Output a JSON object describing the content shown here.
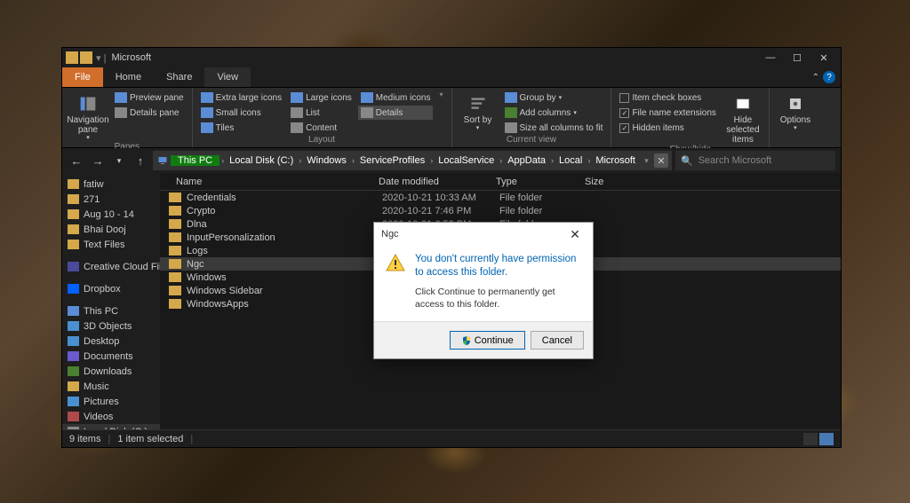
{
  "window": {
    "title": "Microsoft",
    "tabs": {
      "file": "File",
      "home": "Home",
      "share": "Share",
      "view": "View"
    },
    "ribbon": {
      "panes": {
        "label": "Panes",
        "nav_pane": "Navigation pane",
        "preview": "Preview pane",
        "details": "Details pane"
      },
      "layout": {
        "label": "Layout",
        "xl_icons": "Extra large icons",
        "l_icons": "Large icons",
        "m_icons": "Medium icons",
        "s_icons": "Small icons",
        "list": "List",
        "details": "Details",
        "tiles": "Tiles",
        "content": "Content"
      },
      "current": {
        "label": "Current view",
        "sort": "Sort by",
        "group": "Group by",
        "add_cols": "Add columns",
        "size_cols": "Size all columns to fit"
      },
      "show": {
        "label": "Show/hide",
        "item_chk": "Item check boxes",
        "ext": "File name extensions",
        "hidden": "Hidden items",
        "hide_sel": "Hide selected items"
      },
      "options": "Options"
    },
    "breadcrumb": [
      "This PC",
      "Local Disk (C:)",
      "Windows",
      "ServiceProfiles",
      "LocalService",
      "AppData",
      "Local",
      "Microsoft"
    ],
    "search_placeholder": "Search Microsoft",
    "sidebar": {
      "quick": [
        "fatiw",
        "271",
        "Aug 10 - 14",
        "Bhai Dooj",
        "Text Files"
      ],
      "cloud": [
        "Creative Cloud Fil"
      ],
      "dropbox": "Dropbox",
      "pc": "This PC",
      "pc_items": [
        "3D Objects",
        "Desktop",
        "Documents",
        "Downloads",
        "Music",
        "Pictures",
        "Videos",
        "Local Disk (C:)"
      ]
    },
    "columns": {
      "name": "Name",
      "date": "Date modified",
      "type": "Type",
      "size": "Size"
    },
    "rows": [
      {
        "name": "Credentials",
        "date": "2020-10-21 10:33 AM",
        "type": "File folder",
        "size": ""
      },
      {
        "name": "Crypto",
        "date": "2020-10-21 7:46 PM",
        "type": "File folder",
        "size": ""
      },
      {
        "name": "Dlna",
        "date": "2020-10-21 6:52 PM",
        "type": "File folder",
        "size": ""
      },
      {
        "name": "InputPersonalization",
        "date": "",
        "type": "",
        "size": ""
      },
      {
        "name": "Logs",
        "date": "",
        "type": "",
        "size": ""
      },
      {
        "name": "Ngc",
        "date": "",
        "type": "",
        "size": ""
      },
      {
        "name": "Windows",
        "date": "",
        "type": "",
        "size": ""
      },
      {
        "name": "Windows Sidebar",
        "date": "",
        "type": "",
        "size": ""
      },
      {
        "name": "WindowsApps",
        "date": "",
        "type": "",
        "size": ""
      }
    ],
    "selected_row": "Ngc",
    "status": {
      "items": "9 items",
      "selected": "1 item selected"
    }
  },
  "dialog": {
    "title": "Ngc",
    "heading": "You don't currently have permission to access this folder.",
    "sub": "Click Continue to permanently get access to this folder.",
    "continue": "Continue",
    "cancel": "Cancel"
  }
}
